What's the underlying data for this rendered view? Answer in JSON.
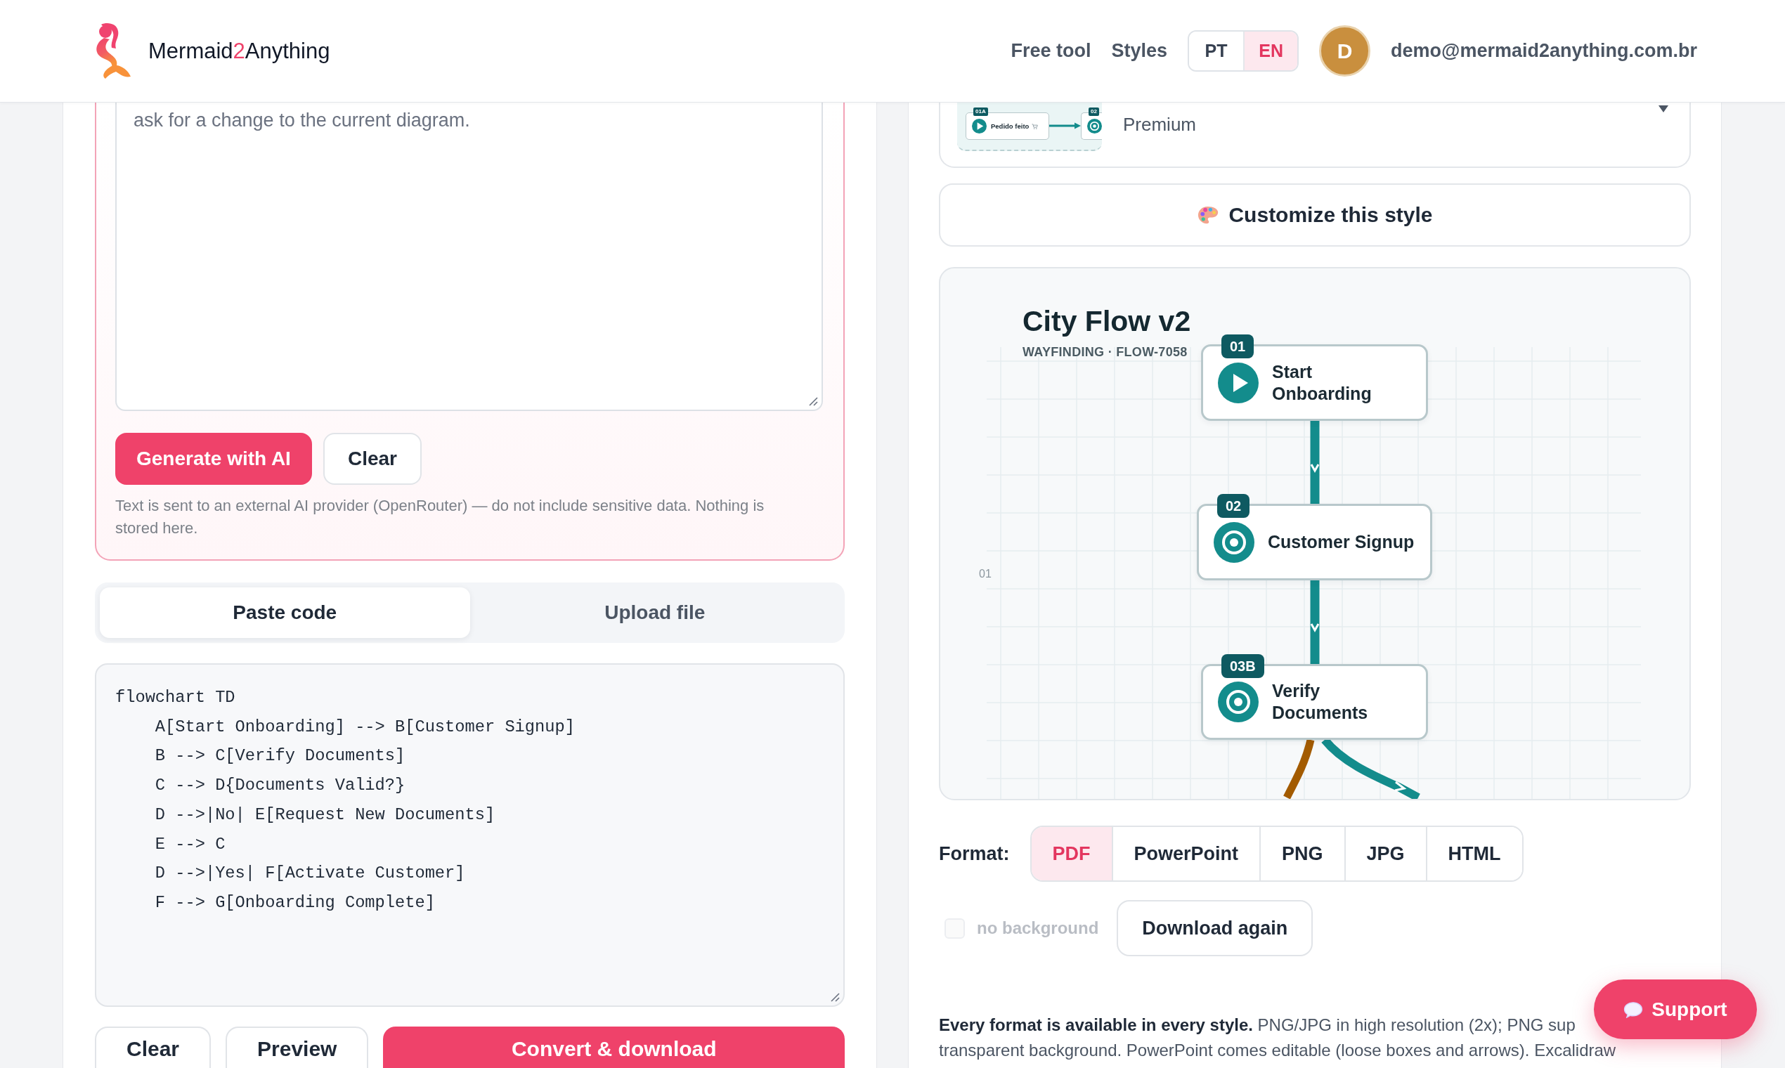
{
  "header": {
    "brand": {
      "start": "Mermaid",
      "accent": "2",
      "end": "Anything"
    },
    "nav": [
      {
        "label": "Free tool"
      },
      {
        "label": "Styles"
      }
    ],
    "languages": [
      {
        "label": "PT",
        "selected": false
      },
      {
        "label": "EN",
        "selected": true
      }
    ],
    "user": {
      "initial": "D",
      "email": "demo@mermaid2anything.com.br"
    }
  },
  "ai_panel": {
    "prompt_value": "ask for a change to the current diagram.",
    "buttons": [
      {
        "label": "Generate with AI",
        "kind": "primary"
      },
      {
        "label": "Clear",
        "kind": "secondary"
      }
    ],
    "note": "Text is sent to an external AI provider (OpenRouter) — do not include sensitive data. Nothing is stored here."
  },
  "input_tabs": [
    {
      "label": "Paste code",
      "selected": true
    },
    {
      "label": "Upload file",
      "selected": false
    }
  ],
  "code_value": "flowchart TD\n    A[Start Onboarding] --> B[Customer Signup]\n    B --> C[Verify Documents]\n    C --> D{Documents Valid?}\n    D -->|No| E[Request New Documents]\n    E --> C\n    D -->|Yes| F[Activate Customer]\n    F --> G[Onboarding Complete]",
  "actions": [
    {
      "label": "Clear",
      "kind": "secondary"
    },
    {
      "label": "Preview",
      "kind": "secondary"
    },
    {
      "label": "Convert & download",
      "kind": "primary"
    }
  ],
  "style_picker": {
    "tier": "Premium",
    "thumbnail": {
      "nodes": [
        {
          "badge": "01A",
          "label": "Pedido feito",
          "kind": "start"
        },
        {
          "badge": "02",
          "kind": "step"
        }
      ]
    }
  },
  "customize_label": "Customize this style",
  "preview": {
    "title": "City Flow v2",
    "subtitle": "WAYFINDING · FLOW-7058",
    "lane_label": "01",
    "nodes": [
      {
        "badge": "01",
        "label": "Start Onboarding",
        "kind": "start"
      },
      {
        "badge": "02",
        "label": "Customer Signup",
        "kind": "step"
      },
      {
        "badge": "03B",
        "label": "Verify Documents",
        "kind": "step"
      }
    ]
  },
  "export": {
    "label": "Format:",
    "formats": [
      {
        "label": "PDF",
        "selected": true
      },
      {
        "label": "PowerPoint",
        "selected": false
      },
      {
        "label": "PNG",
        "selected": false
      },
      {
        "label": "JPG",
        "selected": false
      },
      {
        "label": "HTML",
        "selected": false
      }
    ],
    "no_background": {
      "label": "no background",
      "checked": false,
      "disabled": true
    },
    "download_again": "Download again",
    "description_lines": [
      "**Every format is available in every style.** PNG/JPG in high resolution (2x); PNG sup",
      "transparent background. PowerPoint comes editable (loose boxes and arrows). Excalidraw"
    ]
  },
  "support_label": "Support"
}
